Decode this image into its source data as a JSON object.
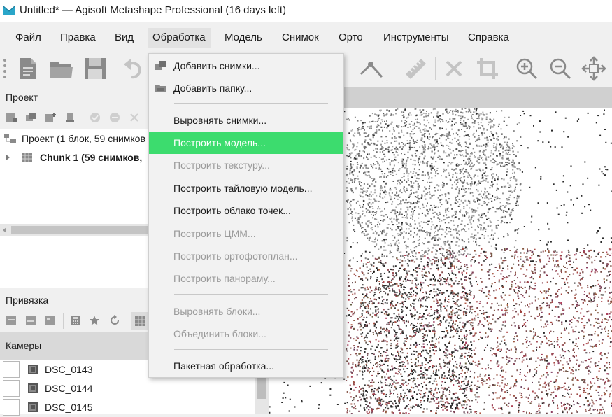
{
  "window": {
    "title": "Untitled* — Agisoft Metashape Professional (16 days left)"
  },
  "menubar": {
    "items": [
      {
        "label": "Файл"
      },
      {
        "label": "Правка"
      },
      {
        "label": "Вид"
      },
      {
        "label": "Обработка",
        "active": true
      },
      {
        "label": "Модель"
      },
      {
        "label": "Снимок"
      },
      {
        "label": "Орто"
      },
      {
        "label": "Инструменты"
      },
      {
        "label": "Справка"
      }
    ]
  },
  "toolbar": {
    "icons": [
      "new-document-icon",
      "open-folder-icon",
      "save-icon",
      "undo-icon",
      "navigation-icon",
      "ruler-icon",
      "delete-icon",
      "crop-icon",
      "zoom-in-icon",
      "zoom-out-icon",
      "move-icon"
    ]
  },
  "project": {
    "title": "Проект",
    "root_label": "Проект (1 блок, 59 снимков",
    "chunk_label": "Chunk 1 (59 снимков,"
  },
  "reference": {
    "title": "Привязка",
    "cameras_header": "Камеры",
    "cameras": [
      {
        "label": "DSC_0143"
      },
      {
        "label": "DSC_0144"
      },
      {
        "label": "DSC_0145"
      }
    ]
  },
  "dropdown": {
    "items": [
      {
        "label": "Добавить снимки...",
        "enabled": true,
        "icon": "add-photos-icon"
      },
      {
        "label": "Добавить папку...",
        "enabled": true,
        "icon": "add-folder-icon"
      },
      {
        "label": "Выровнять снимки...",
        "enabled": true
      },
      {
        "label": "Построить модель...",
        "enabled": true,
        "highlighted": true
      },
      {
        "label": "Построить текстуру...",
        "enabled": false
      },
      {
        "label": "Построить тайловую модель...",
        "enabled": true
      },
      {
        "label": "Построить облако точек...",
        "enabled": true
      },
      {
        "label": "Построить ЦММ...",
        "enabled": false
      },
      {
        "label": "Построить ортофотоплан...",
        "enabled": false
      },
      {
        "label": "Построить панораму...",
        "enabled": false
      },
      {
        "label": "Выровнять блоки...",
        "enabled": false
      },
      {
        "label": "Объединить блоки...",
        "enabled": false
      },
      {
        "label": "Пакетная обработка...",
        "enabled": true
      }
    ],
    "highlight_color": "#3cdc6e"
  }
}
